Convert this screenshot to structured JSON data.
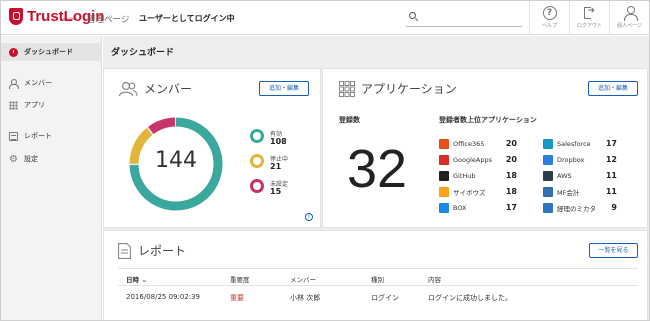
{
  "header": {
    "logo_text": "TrustLogin",
    "logo_sub": "by GMO",
    "admin_page": "管理ページ",
    "login_as_user": "ユーザーとしてログイン中",
    "buttons": [
      {
        "label": "ヘルプ",
        "icon": "help-icon"
      },
      {
        "label": "ログアウト",
        "icon": "logout-icon"
      },
      {
        "label": "個人ページ",
        "icon": "user-icon"
      }
    ]
  },
  "sidebar": {
    "items": [
      {
        "label": "ダッシュボード",
        "icon": "dashboard-icon",
        "active": true
      },
      {
        "label": "メンバー",
        "icon": "member-icon"
      },
      {
        "label": "アプリ",
        "icon": "apps-icon"
      },
      {
        "label": "レポート",
        "icon": "report-icon"
      },
      {
        "label": "設定",
        "icon": "gear-icon"
      }
    ]
  },
  "main": {
    "title": "ダッシュボード",
    "members": {
      "title": "メンバー",
      "edit_button": "追加・編集",
      "total": "144",
      "legend": [
        {
          "label": "有効",
          "value": "108",
          "color": "#3aa89d"
        },
        {
          "label": "停止中",
          "value": "21",
          "color": "#e3b43a"
        },
        {
          "label": "未設定",
          "value": "15",
          "color": "#c9336b"
        }
      ]
    },
    "applications": {
      "title": "アプリケーション",
      "edit_button": "追加・編集",
      "registered_label": "登録数",
      "registered_count": "32",
      "top_apps_title": "登録者数上位アプリケーション",
      "left": [
        {
          "name": "Office365",
          "count": "20",
          "color": "#e8501a"
        },
        {
          "name": "GoogleApps",
          "count": "20",
          "color": "#d93025"
        },
        {
          "name": "GitHub",
          "count": "18",
          "color": "#222222"
        },
        {
          "name": "サイボウズ",
          "count": "18",
          "color": "#f6a31c"
        },
        {
          "name": "BOX",
          "count": "17",
          "color": "#1e88e5"
        }
      ],
      "right": [
        {
          "name": "Salesforce",
          "count": "17",
          "color": "#1798c1"
        },
        {
          "name": "Dropbox",
          "count": "12",
          "color": "#2a7de1"
        },
        {
          "name": "AWS",
          "count": "11",
          "color": "#2f3e4e"
        },
        {
          "name": "MF会計",
          "count": "11",
          "color": "#2f6db5"
        },
        {
          "name": "経理のミカタ",
          "count": "9",
          "color": "#2a76bf"
        }
      ]
    },
    "report": {
      "title": "レポート",
      "view_all_button": "一覧を見る",
      "columns": [
        "日時",
        "重要度",
        "メンバー",
        "種別",
        "内容"
      ],
      "rows": [
        {
          "datetime": "2016/08/25 09:02:39",
          "severity": "重要",
          "member": "小林 次郎",
          "type": "ログイン",
          "content": "ログインに成功しました。"
        }
      ]
    }
  }
}
